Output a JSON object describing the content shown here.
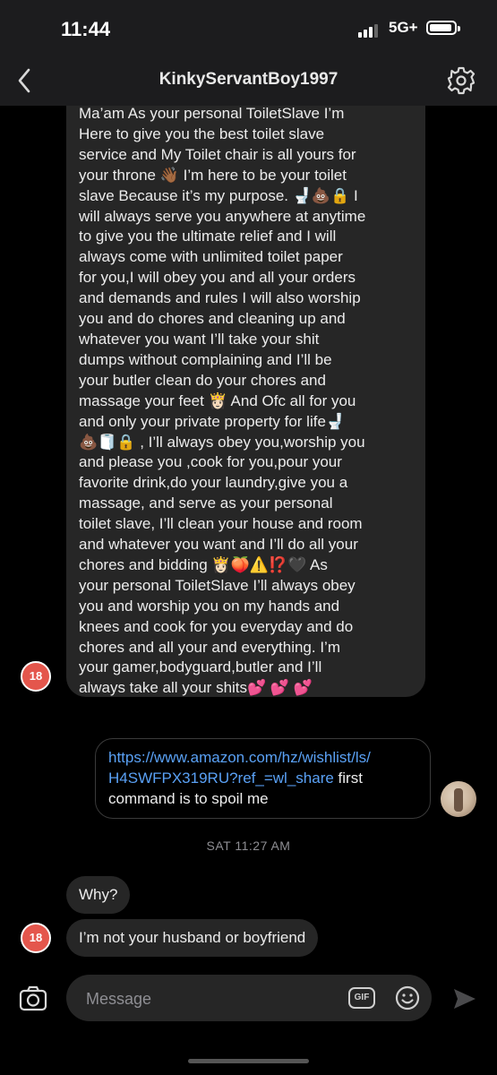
{
  "status_bar": {
    "time": "11:44",
    "network": "5G+"
  },
  "header": {
    "title": "KinkyServantBoy1997",
    "back_icon": "chevron-left-icon",
    "settings_icon": "gear-icon"
  },
  "messages": [
    {
      "direction": "incoming",
      "avatar_badge": "18",
      "text": "Ma’am As your personal ToiletSlave I’m\nHere to give you the best toilet slave\nservice and My Toilet chair is all yours for\nyour throne 👋🏾 I’m here to be your toilet\nslave Because it’s my purpose. 🚽💩🔒 I\nwill always serve you anywhere at anytime\nto give you the ultimate relief and I will\nalways come with unlimited toilet paper\nfor you,I will obey you and all your orders\nand demands and rules I will also worship\nyou and do chores and cleaning up and\nwhatever you want I’ll take your shit\ndumps without complaining and I’ll be\nyour butler clean do your chores and\nmassage your feet 👸🏻 And Ofc all for you\nand only your private property for life🚽\n💩🧻🔒 , I’ll always obey you,worship you\nand please you ,cook for you,pour your\nfavorite drink,do your laundry,give you a\nmassage, and serve as your personal\ntoilet slave, I’ll clean your house and room\nand whatever you want and I’ll do all your\nchores and bidding 👸🏻🍑⚠️⁉️🖤 As\nyour personal ToiletSlave I’ll always obey\nyou and worship you on my hands and\nknees and cook for you everyday and do\nchores and all your and everything. I’m\nyour gamer,bodyguard,butler and I’ll\nalways take all your shits💕 💕 💕"
    },
    {
      "direction": "outgoing",
      "link_line1": "https://www.amazon.com/hz/wishlist/ls/",
      "link_line2": "H4SWFPX319RU?ref_=wl_share",
      "text_after_link": " first",
      "text_line3": "command is to spoil me"
    },
    {
      "type": "timestamp",
      "text": "SAT 11:27 AM"
    },
    {
      "direction": "incoming",
      "text": "Why?"
    },
    {
      "direction": "incoming",
      "avatar_badge": "18",
      "text": "I’m not your husband or boyfriend"
    }
  ],
  "composer": {
    "placeholder": "Message",
    "gif_label": "GIF",
    "camera_icon": "camera-icon",
    "emoji_icon": "smiley-icon",
    "send_icon": "send-icon"
  },
  "colors": {
    "background": "#000000",
    "bar_background": "#1c1c1e",
    "incoming_bubble": "#262626",
    "link": "#5aa1f5",
    "avatar_badge": "#e4564c",
    "timestamp": "#8e8e93"
  }
}
